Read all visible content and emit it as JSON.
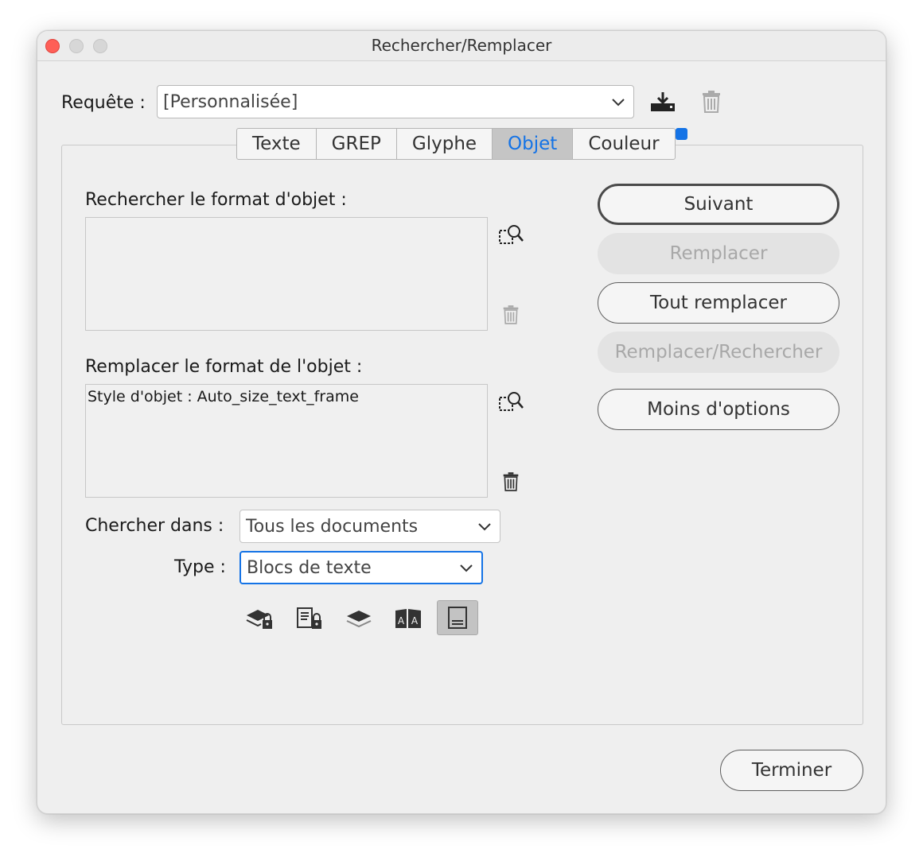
{
  "window": {
    "title": "Rechercher/Remplacer"
  },
  "query": {
    "label": "Requête :",
    "value": "[Personnalisée]",
    "save_icon": "save-query-icon",
    "delete_icon": "trash-icon"
  },
  "tabs": [
    {
      "label": "Texte",
      "active": false
    },
    {
      "label": "GREP",
      "active": false
    },
    {
      "label": "Glyphe",
      "active": false
    },
    {
      "label": "Objet",
      "active": true
    },
    {
      "label": "Couleur",
      "active": false
    }
  ],
  "find_format": {
    "label": "Rechercher le format d'objet :",
    "value": ""
  },
  "replace_format": {
    "label": "Remplacer le format de l'objet :",
    "value": "Style d'objet : Auto_size_text_frame"
  },
  "search_in": {
    "label": "Chercher dans :",
    "value": "Tous les documents"
  },
  "type": {
    "label": "Type :",
    "value": "Blocs de texte"
  },
  "buttons": {
    "next": "Suivant",
    "replace": "Remplacer",
    "replace_all": "Tout remplacer",
    "replace_find": "Remplacer/Rechercher",
    "fewer_options": "Moins d'options",
    "done": "Terminer"
  },
  "options_icons": [
    "locked-layers-icon",
    "locked-stories-icon",
    "hidden-layers-icon",
    "master-pages-icon",
    "footnotes-icon"
  ],
  "colors": {
    "accent": "#1473e6",
    "close": "#fe5f57"
  }
}
